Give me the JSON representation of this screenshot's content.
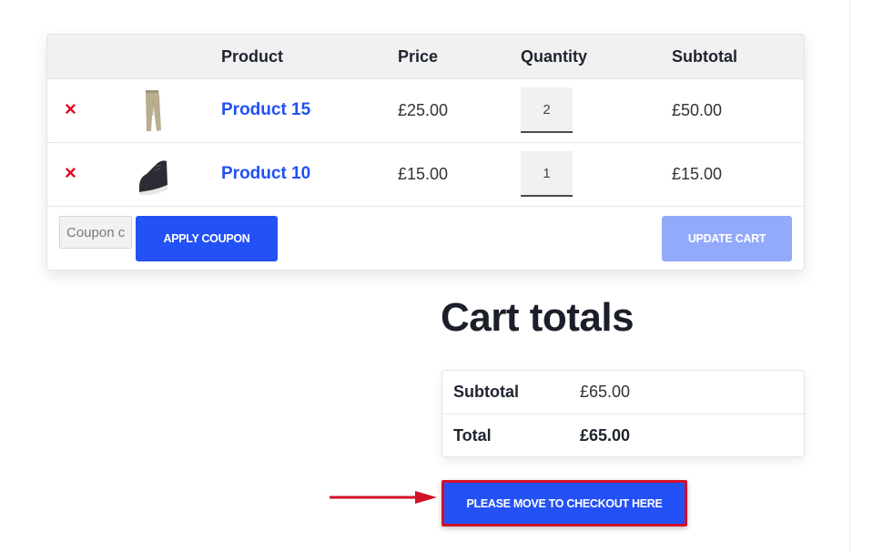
{
  "cart": {
    "headers": {
      "product": "Product",
      "price": "Price",
      "quantity": "Quantity",
      "subtotal": "Subtotal"
    },
    "items": [
      {
        "remove_icon": "×",
        "thumbnail": "trousers-thumbnail",
        "name": "Product 15",
        "price": "£25.00",
        "quantity": "2",
        "subtotal": "£50.00"
      },
      {
        "remove_icon": "×",
        "thumbnail": "shoe-thumbnail",
        "name": "Product 10",
        "price": "£15.00",
        "quantity": "1",
        "subtotal": "£15.00"
      }
    ],
    "coupon": {
      "placeholder": "Coupon code",
      "visible_text": "Coupon c"
    },
    "apply_coupon_label": "APPLY COUPON",
    "update_cart_label": "UPDATE CART"
  },
  "totals": {
    "title": "Cart totals",
    "subtotal_label": "Subtotal",
    "subtotal_value": "£65.00",
    "total_label": "Total",
    "total_value": "£65.00"
  },
  "checkout": {
    "label": "PLEASE MOVE TO CHECKOUT HERE"
  },
  "colors": {
    "accent": "#2351f5",
    "accent_disabled": "#93aafb",
    "remove": "#e2061f",
    "highlight": "#d2112a",
    "link": "#2250f4"
  }
}
